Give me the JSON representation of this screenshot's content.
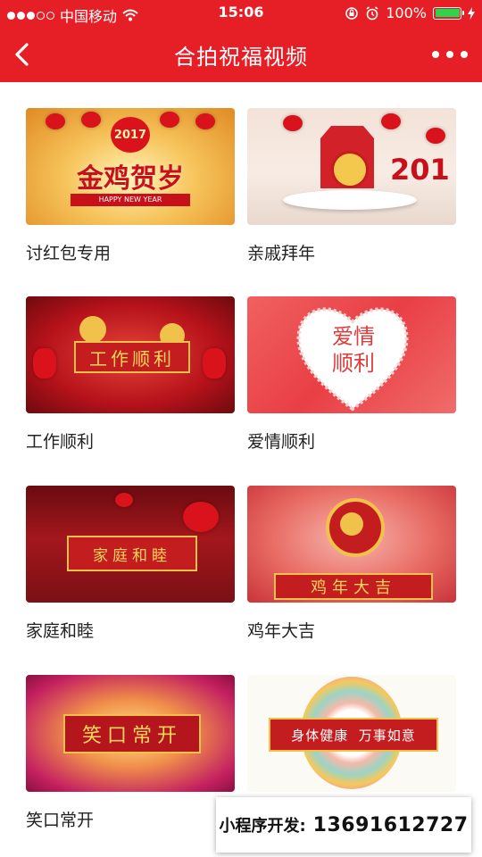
{
  "status_bar": {
    "carrier": "中国移动",
    "time": "15:06",
    "battery_percent": "100%",
    "battery_level": 1.0
  },
  "nav": {
    "title": "合拍祝福视频"
  },
  "cards": [
    {
      "label": "讨红包专用",
      "thumb_text": "金鸡贺岁",
      "thumb_sub": "HAPPY NEW YEAR",
      "thumb_year": "2017"
    },
    {
      "label": "亲戚拜年",
      "thumb_year": "201"
    },
    {
      "label": "工作顺利",
      "thumb_text": "工作顺利"
    },
    {
      "label": "爱情顺利",
      "thumb_text": "爱情\n顺利"
    },
    {
      "label": "家庭和睦",
      "thumb_text": "家庭和睦"
    },
    {
      "label": "鸡年大吉",
      "thumb_text": "鸡年大吉"
    },
    {
      "label": "笑口常开",
      "thumb_text": "笑口常开"
    },
    {
      "label": "",
      "thumb_text": "身体健康  万事如意"
    }
  ],
  "ad": {
    "label": "小程序开发:",
    "phone": "13691612727"
  },
  "colors": {
    "brand_red": "#e61f27",
    "battery_green": "#2fd24a"
  }
}
